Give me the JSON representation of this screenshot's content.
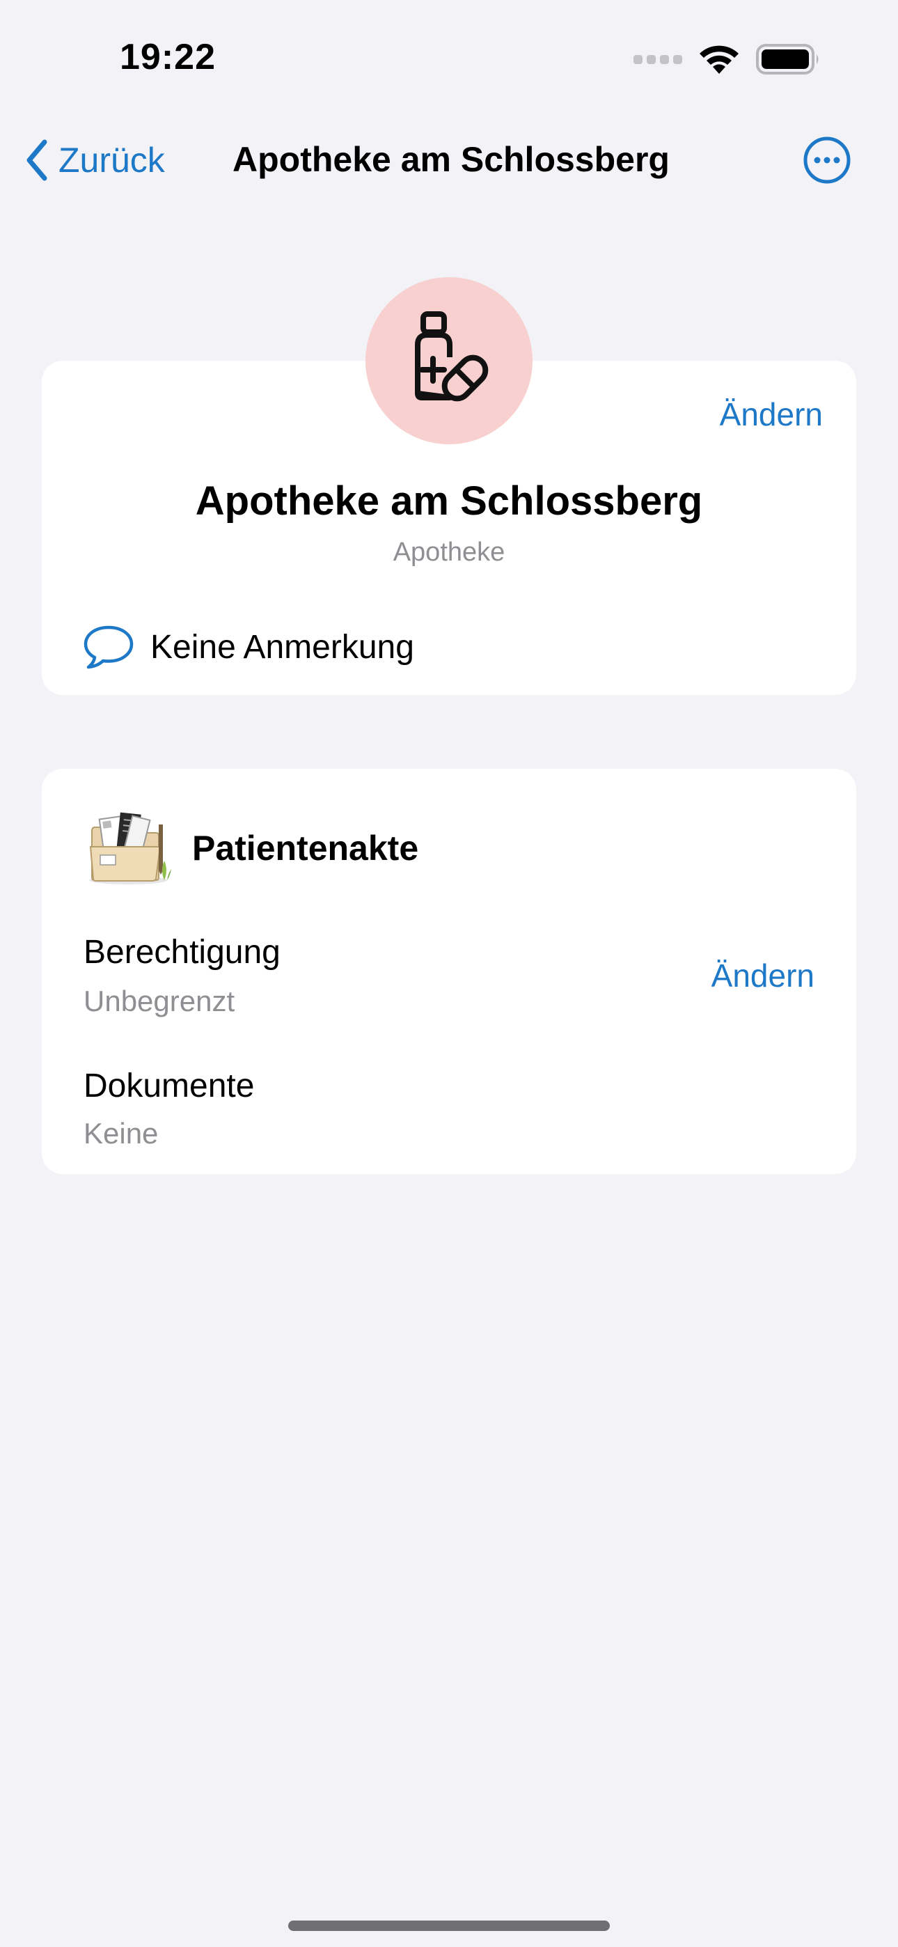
{
  "status_bar": {
    "time": "19:22"
  },
  "nav": {
    "back_label": "Zurück",
    "title": "Apotheke am Schlossberg",
    "more_icon": "ellipsis-circle-icon"
  },
  "contact": {
    "name": "Apotheke am Schlossberg",
    "type": "Apotheke",
    "edit_label": "Ändern",
    "avatar_icon": "pharmacy-bottle-pill-icon",
    "note_icon": "speech-bubble-icon",
    "note": "Keine Anmerkung"
  },
  "record": {
    "title": "Patientenakte",
    "icon": "patient-record-folder-icon",
    "permission_label": "Berechtigung",
    "permission_value": "Unbegrenzt",
    "permission_edit_label": "Ändern",
    "documents_label": "Dokumente",
    "documents_value": "Keine"
  },
  "colors": {
    "accent": "#1e78c8",
    "background": "#f2f2f7",
    "avatar_bg": "#f8d0cf",
    "secondary_text": "#8e8e93"
  }
}
